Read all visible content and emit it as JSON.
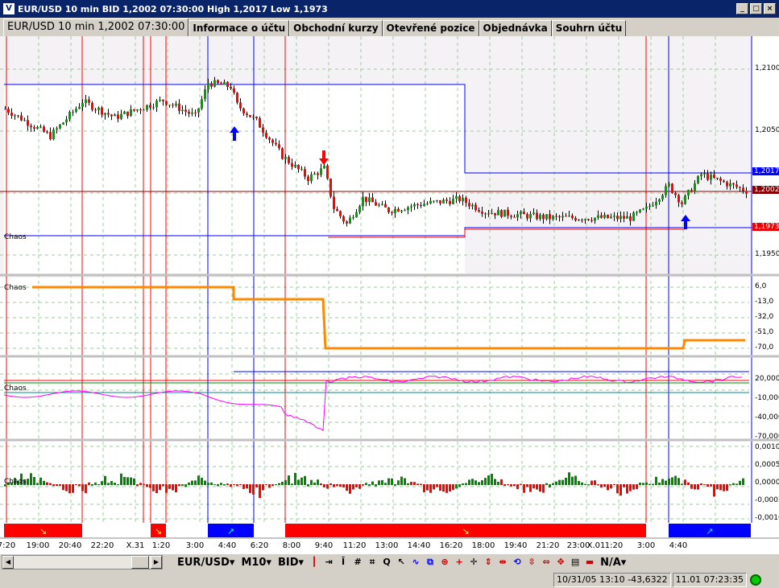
{
  "window": {
    "title": "EUR/USD 10 min BID 1,2002 07:30:00 High 1,2017 Low 1,1973",
    "buttons": [
      "minimize",
      "maximize",
      "close"
    ]
  },
  "tabs": [
    {
      "label": "EUR/USD 10 min 1,2002 07:30:00",
      "active": true
    },
    {
      "label": "Informace o účtu"
    },
    {
      "label": "Obchodní kurzy"
    },
    {
      "label": "Otevřené pozice"
    },
    {
      "label": "Objednávka"
    },
    {
      "label": "Souhrn účtu"
    }
  ],
  "main_panel": {
    "label": "Chaos",
    "y_ticks": [
      "1,2100",
      "1,2050",
      "1,2000",
      "1,1950"
    ],
    "price_labels": {
      "high": "1,2017",
      "bid": "1,2002",
      "low": "1,1973"
    },
    "price_keypoints": [
      [
        0,
        1.2068
      ],
      [
        14,
        1.2046
      ],
      [
        24,
        1.2074
      ],
      [
        34,
        1.2061
      ],
      [
        49,
        1.2075
      ],
      [
        59,
        1.2062
      ],
      [
        63,
        1.2089
      ],
      [
        70,
        1.2086
      ],
      [
        72,
        1.2071
      ],
      [
        78,
        1.2058
      ],
      [
        86,
        1.203
      ],
      [
        94,
        1.2012
      ],
      [
        99,
        1.202
      ],
      [
        102,
        1.1988
      ],
      [
        106,
        1.1975
      ],
      [
        111,
        1.1996
      ],
      [
        119,
        1.1986
      ],
      [
        129,
        1.1991
      ],
      [
        141,
        1.1995
      ],
      [
        149,
        1.1985
      ],
      [
        169,
        1.198
      ],
      [
        194,
        1.198
      ],
      [
        199,
        1.1987
      ],
      [
        206,
        1.2006
      ],
      [
        210,
        1.1992
      ],
      [
        216,
        1.2015
      ],
      [
        230,
        1.2002
      ]
    ]
  },
  "panel2": {
    "label": "Chaos",
    "y_ticks": [
      "6,0",
      "-13,0",
      "-32,0",
      "-51,0",
      "-70,0"
    ]
  },
  "panel3": {
    "label": "Chaos",
    "y_ticks": [
      "20,000",
      "-10,000",
      "-40,000",
      "-70,000"
    ]
  },
  "panel4": {
    "label": "Chaos",
    "y_ticks": [
      "0,0010",
      "0,0005",
      "0,0000",
      "-0,0005",
      "-0,0010"
    ]
  },
  "x_labels": [
    "7:20",
    "19:00",
    "20:40",
    "22:20",
    "X.31",
    "1:20",
    "3:00",
    "4:40",
    "6:20",
    "8:00",
    "9:40",
    "11:20",
    "13:00",
    "14:40",
    "16:20",
    "18:00",
    "19:40",
    "21:20",
    "23:00",
    "X.01",
    "1:20",
    "3:00",
    "4:40"
  ],
  "toolbar": {
    "symbol": "EUR/USD",
    "period": "M10",
    "price_type": "BID",
    "right": "N/A"
  },
  "status": {
    "cursor": "10/31/05 13:10  -43,6322",
    "clock": "11.01 07:23:35"
  },
  "colors": {
    "up": "#00a000",
    "down": "#ff0000",
    "signal_buy": "#0000ff",
    "signal_sell": "#ff0000"
  }
}
